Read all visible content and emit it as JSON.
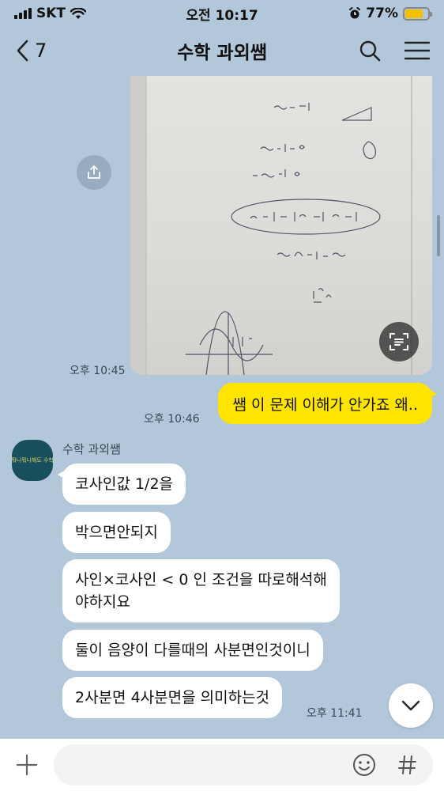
{
  "status_bar": {
    "carrier": "SKT",
    "time": "오전 10:17",
    "battery": "77%",
    "battery_level": 0.77
  },
  "header": {
    "back_count": "7",
    "title": "수학 과외쌤"
  },
  "photo_message": {
    "time": "오후 10:45"
  },
  "outgoing_message": {
    "text": "쌤 이 문제 이해가 안가죠 왜..",
    "time": "오후 10:46"
  },
  "incoming": {
    "sender": "수학 과외쌤",
    "avatar_text": "뭐니뭐니해도 수학",
    "messages": [
      {
        "text": "코사인값 1/2을"
      },
      {
        "text": "박으면안되지"
      },
      {
        "text": "사인×코사인 < 0 인 조건을 따로해석해\n야하지요"
      },
      {
        "text": "둘이 음양이 다를때의 사분면인것이니"
      },
      {
        "text": "2사분면 4사분면을 의미하는것"
      }
    ],
    "time": "오후 11:41"
  },
  "input": {
    "placeholder": ""
  },
  "icons": {
    "back": "chevron-left-icon",
    "search": "search-icon",
    "menu": "hamburger-icon",
    "share": "share-icon",
    "scan": "text-scan-icon",
    "scroll_down": "chevron-down-icon",
    "attach": "plus-icon",
    "emoji": "emoji-icon",
    "hashtag": "hashtag-icon"
  },
  "colors": {
    "chat_bg": "#b2c7d9",
    "outgoing_bubble": "#fee500",
    "incoming_bubble": "#ffffff",
    "battery": "#f2c200"
  }
}
